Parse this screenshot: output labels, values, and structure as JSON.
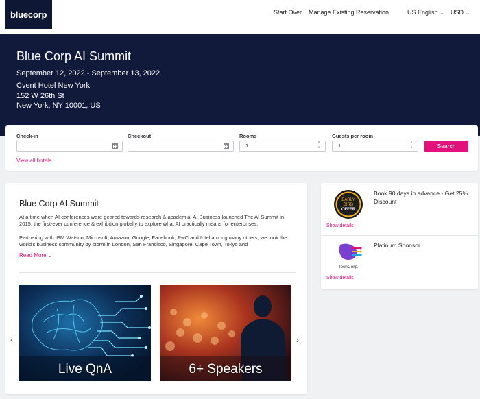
{
  "nav": {
    "logo_text": "bluecorp",
    "links": [
      "Start Over",
      "Manage Existing Reservation"
    ],
    "language": "US English",
    "currency": "USD"
  },
  "hero": {
    "title": "Blue Corp AI Summit",
    "dates": "September 12, 2022 - September 13, 2022",
    "venue": "Cvent Hotel New York",
    "street": "152 W 26th St",
    "city": "New York, NY 10001, US"
  },
  "search": {
    "checkin_label": "Check-in",
    "checkin_value": "",
    "checkout_label": "Checkout",
    "checkout_value": "",
    "rooms_label": "Rooms",
    "rooms_value": "1",
    "guests_label": "Guests per room",
    "guests_value": "1",
    "search_label": "Search",
    "view_all": "View all hotels"
  },
  "event": {
    "title": "Blue Corp AI Summit",
    "paragraph1": "At a time when AI conferences were geared towards research & academia, AI Business launched The AI Summit in 2015; the first-ever conference & exhibition globally to explore what AI practically means for enterprises.",
    "paragraph2": "Partnering with IBM Watson, Microsoft, Amazon, Google, Facebook, PwC and Intel among many others, we took the world's business community by storm in London, San Francisco, Singapore, Cape Town, Tokyo and",
    "read_more": "Read More",
    "slides": [
      "Live QnA",
      "6+ Speakers"
    ]
  },
  "offers": [
    {
      "text": "Book 90 days in advance - Get 25% Discount",
      "badge_line1": "EARLY",
      "badge_line2": "BIRD",
      "badge_line3": "OFFER",
      "details": "Show details"
    },
    {
      "text": "Platinum Sponsor",
      "brand": "TechCorp.",
      "details": "Show details"
    }
  ],
  "colors": {
    "accent": "#e2117b",
    "navy": "#121a3c"
  }
}
